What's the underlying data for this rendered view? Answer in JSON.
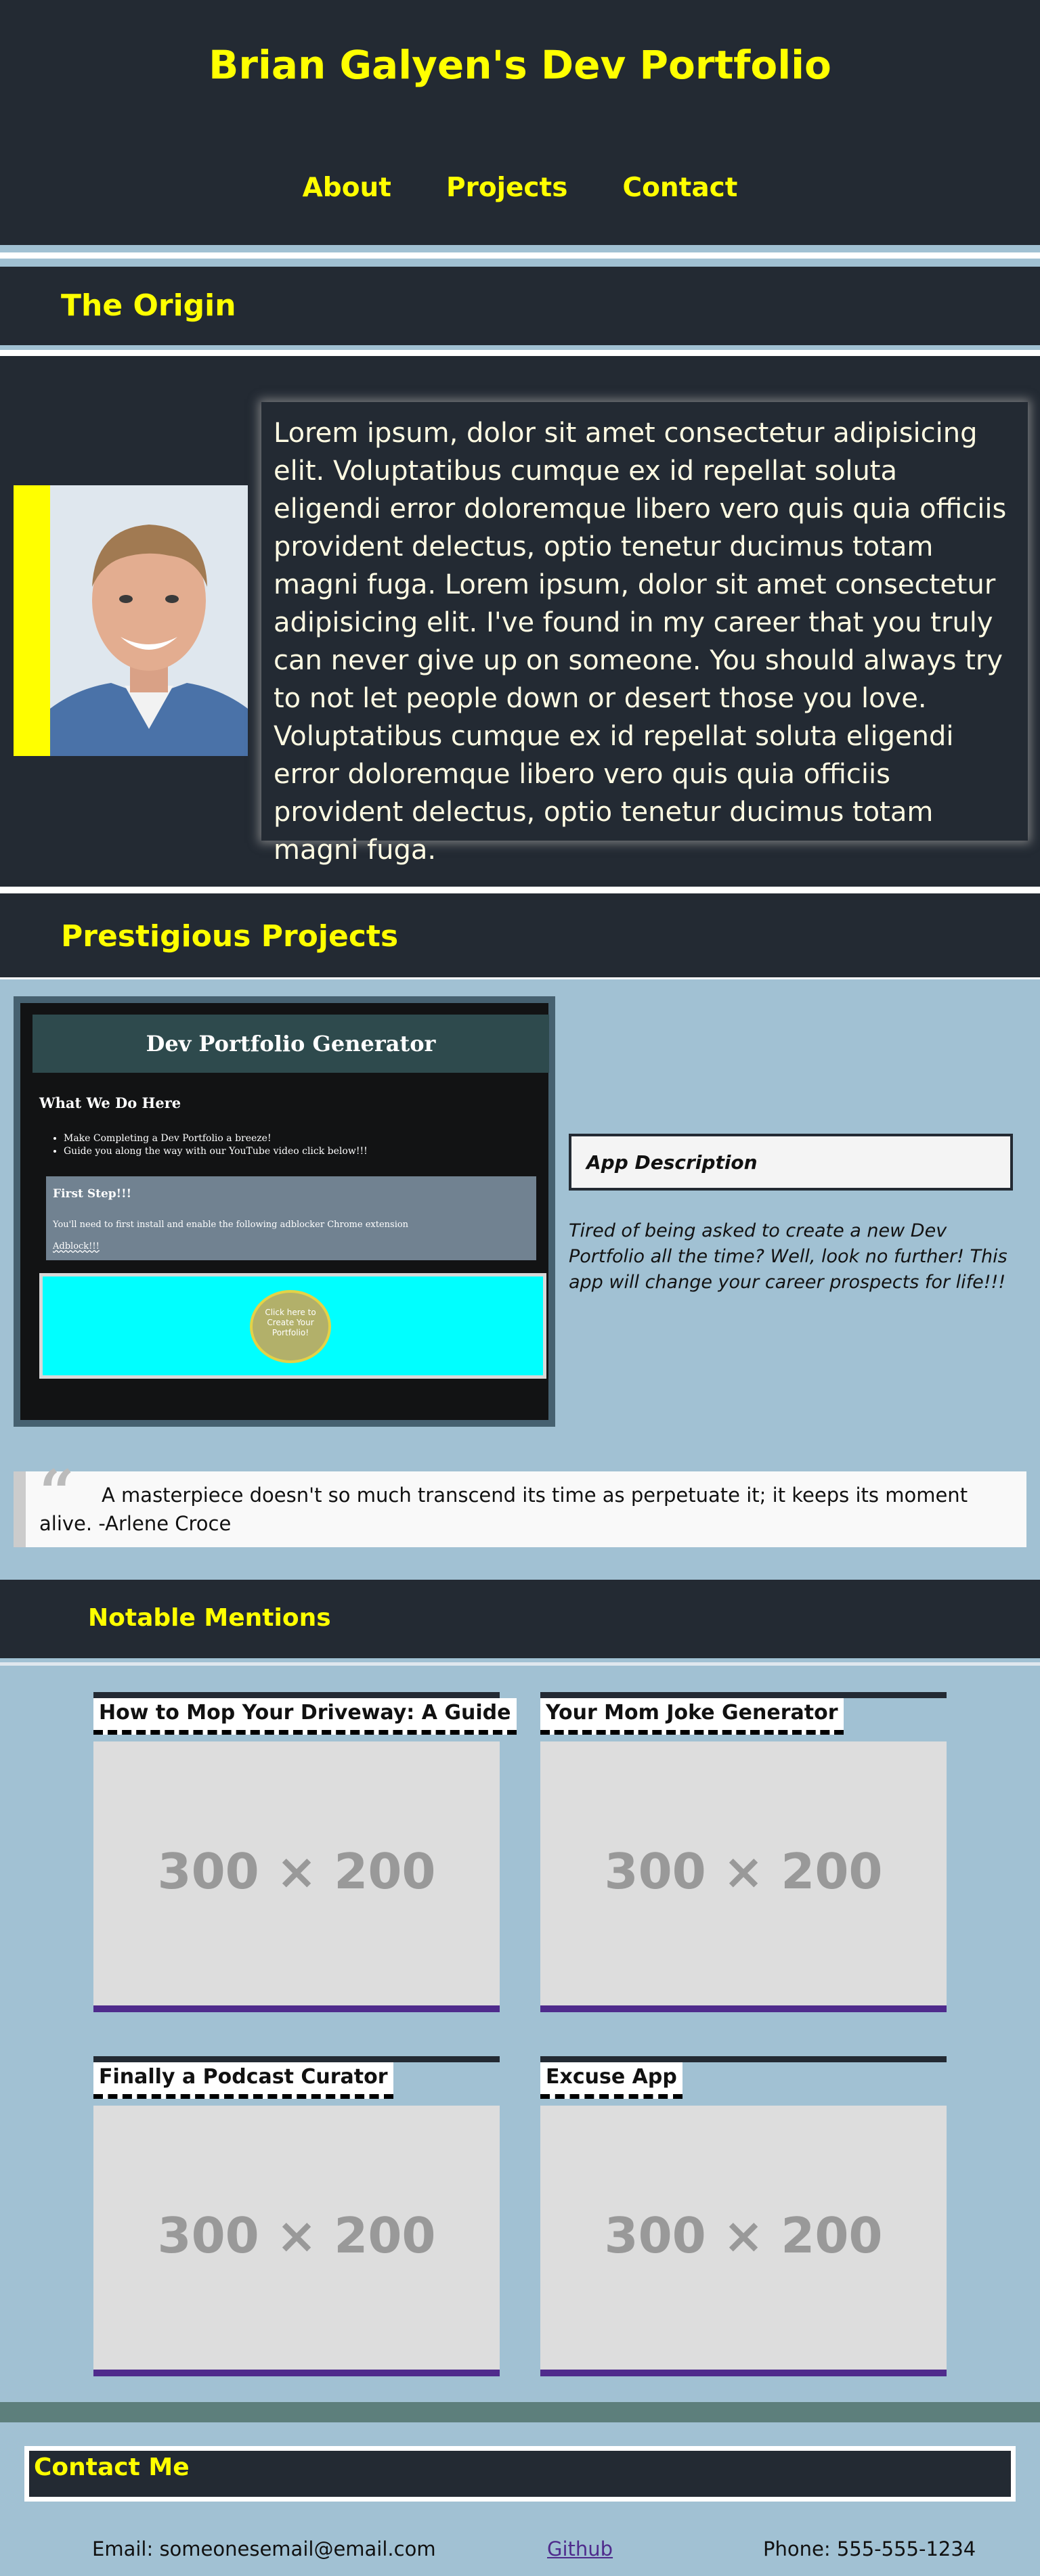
{
  "header": {
    "title": "Brian Galyen's Dev Portfolio",
    "nav": [
      "About",
      "Projects",
      "Contact"
    ]
  },
  "origin": {
    "heading": "The Origin",
    "photo_alt": "profile-photo",
    "text": "Lorem ipsum, dolor sit amet consectetur adipisicing elit. Voluptatibus cumque ex id repellat soluta eligendi error doloremque libero vero quis quia officiis provident delectus, optio tenetur ducimus totam magni fuga. Lorem ipsum, dolor sit amet consectetur adipisicing elit. I've found in my career that you truly can never give up on someone. You should always try to not let people down or desert those you love. Voluptatibus cumque ex id repellat soluta eligendi error doloremque libero vero quis quia officiis provident delectus, optio tenetur ducimus totam magni fuga."
  },
  "projects": {
    "heading": "Prestigious Projects",
    "preview": {
      "title": "Dev Portfolio Generator",
      "subtitle": "What We Do Here",
      "bullets": [
        "Make Completing a Dev Portfolio a breeze!",
        "Guide you along the way with our YouTube video click below!!!"
      ],
      "step_title": "First Step!!!",
      "step_text": "You'll need to first install and enable the following adblocker Chrome extension",
      "step_link": "Adblock!!!",
      "cta": "Click here to Create Your Portfolio!"
    },
    "description_title": "App Description",
    "description": "Tired of being asked to create a new Dev Portfolio all the time? Well, look no further! This app will change your career prospects for life!!!"
  },
  "quote": {
    "mark": "“",
    "text": "A masterpiece doesn't so much transcend its time as perpetuate it; it keeps its moment alive. -Arlene Croce"
  },
  "mentions": {
    "heading": "Notable Mentions",
    "placeholder": "300 × 200",
    "cards": [
      {
        "title": "How to Mop Your Driveway: A Guide"
      },
      {
        "title": "Your Mom Joke Generator"
      },
      {
        "title": "Finally a Podcast Curator"
      },
      {
        "title": "Excuse App"
      }
    ]
  },
  "contact": {
    "heading": "Contact Me",
    "email": "Email: someonesemail@email.com",
    "github": "Github",
    "phone": "Phone: 555-555-1234"
  },
  "colors": {
    "background": "#a1c1d3",
    "dark": "#232a33",
    "accent": "#ffff00",
    "card_border": "#4f2b8c"
  }
}
